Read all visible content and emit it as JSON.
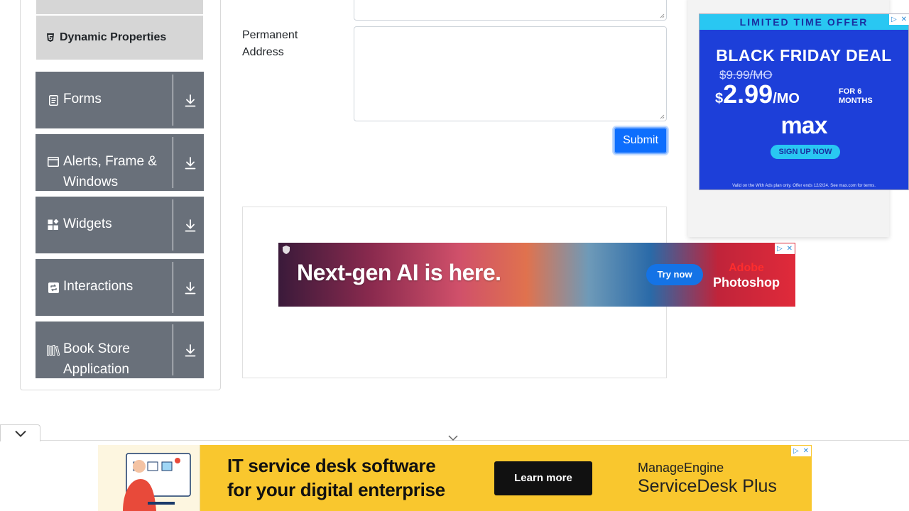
{
  "sidebar": {
    "active_subitem": "Dynamic Properties",
    "groups": [
      {
        "label": "Forms",
        "icon": "document-icon"
      },
      {
        "label": "Alerts, Frame & Windows",
        "icon": "window-icon"
      },
      {
        "label": "Widgets",
        "icon": "widgets-icon"
      },
      {
        "label": "Interactions",
        "icon": "interactions-icon"
      },
      {
        "label": "Book Store Application",
        "icon": "books-icon"
      }
    ]
  },
  "form": {
    "permanent_address_label": "Permanent Address",
    "permanent_address_value": "",
    "submit_label": "Submit"
  },
  "ads": {
    "right": {
      "strip": "LIMITED TIME OFFER",
      "headline": "BLACK FRIDAY DEAL",
      "old_price": "$9.99/MO",
      "new_price_dollar": "$",
      "new_price": "2.99",
      "new_price_unit": "/MO",
      "period": "FOR 6 MONTHS",
      "brand": "max",
      "cta": "SIGN UP NOW",
      "fine_print": "Valid on the With Ads plan only. Offer ends 12/2/24. See max.com for terms."
    },
    "middle": {
      "text": "Next-gen AI is here.",
      "cta": "Try now",
      "brand_line1": "Adobe",
      "brand_line2": "Photoshop"
    },
    "bottom": {
      "line1": "IT service desk software",
      "line2": "for your digital enterprise",
      "cta": "Learn more",
      "brand_line1": "ManageEngine",
      "brand_line2": "ServiceDesk Plus"
    }
  },
  "colors": {
    "sidebar_group_bg": "#69707a",
    "subitem_bg": "#d6d6d6",
    "submit_bg": "#0d6efd",
    "max_ad_bg": "#1d3fd9",
    "bottom_ad_bg": "#f9c72e"
  }
}
